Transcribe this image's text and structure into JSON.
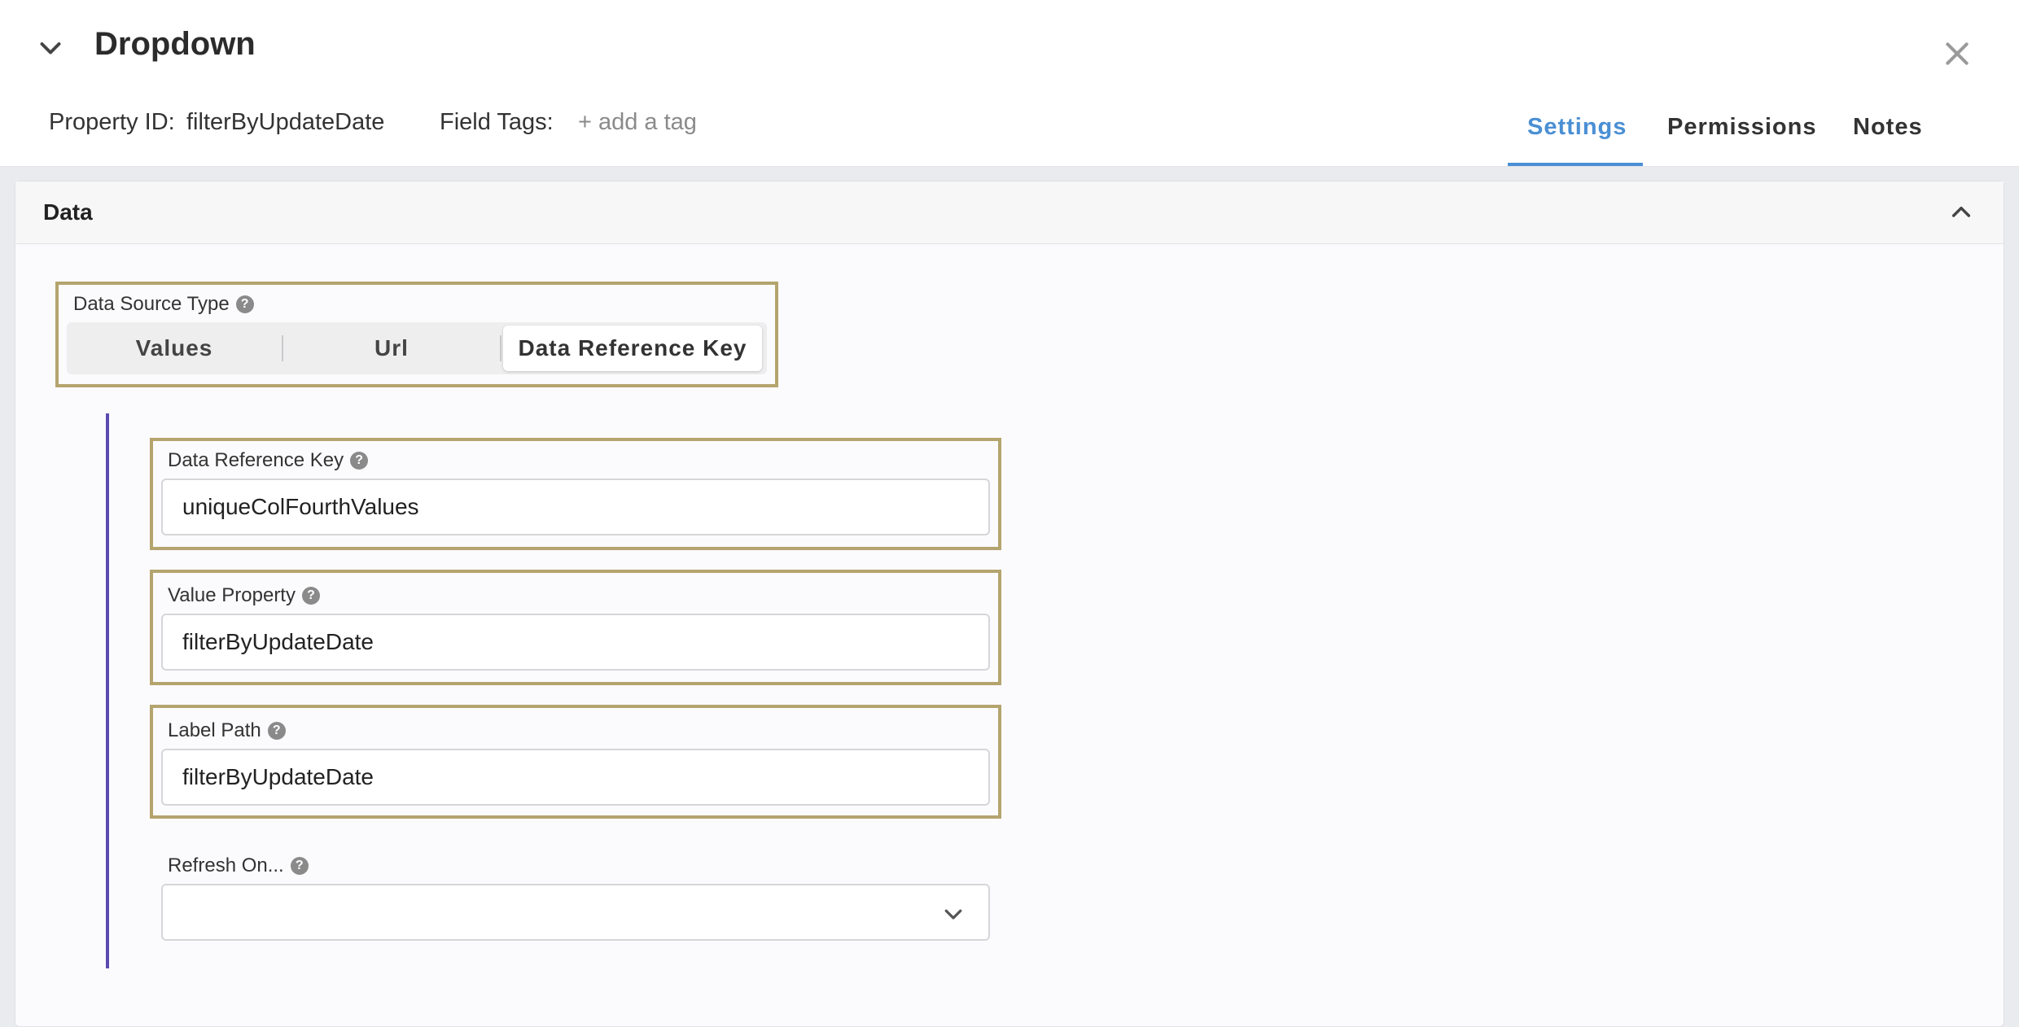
{
  "header": {
    "title": "Dropdown",
    "property_id_label": "Property ID:",
    "property_id_value": "filterByUpdateDate",
    "field_tags_label": "Field Tags:",
    "add_tag_label": "+ add a tag",
    "tabs": [
      {
        "label": "Settings",
        "active": true
      },
      {
        "label": "Permissions",
        "active": false
      },
      {
        "label": "Notes",
        "active": false
      }
    ]
  },
  "data_panel": {
    "title": "Data",
    "data_source_type": {
      "label": "Data Source Type",
      "options": [
        "Values",
        "Url",
        "Data Reference Key"
      ],
      "selected": "Data Reference Key"
    },
    "fields": {
      "data_reference_key": {
        "label": "Data Reference Key",
        "value": "uniqueColFourthValues"
      },
      "value_property": {
        "label": "Value Property",
        "value": "filterByUpdateDate"
      },
      "label_path": {
        "label": "Label Path",
        "value": "filterByUpdateDate"
      },
      "refresh_on": {
        "label": "Refresh On...",
        "value": ""
      }
    }
  },
  "icons": {
    "collapse": "chevron-down-icon",
    "close": "close-icon",
    "panel_collapse": "chevron-up-icon",
    "help": "help-icon",
    "select": "chevron-down-icon"
  },
  "colors": {
    "accent": "#4a8fd4",
    "highlight_border": "#b4a46e",
    "indent_line": "#5b4ab0"
  }
}
